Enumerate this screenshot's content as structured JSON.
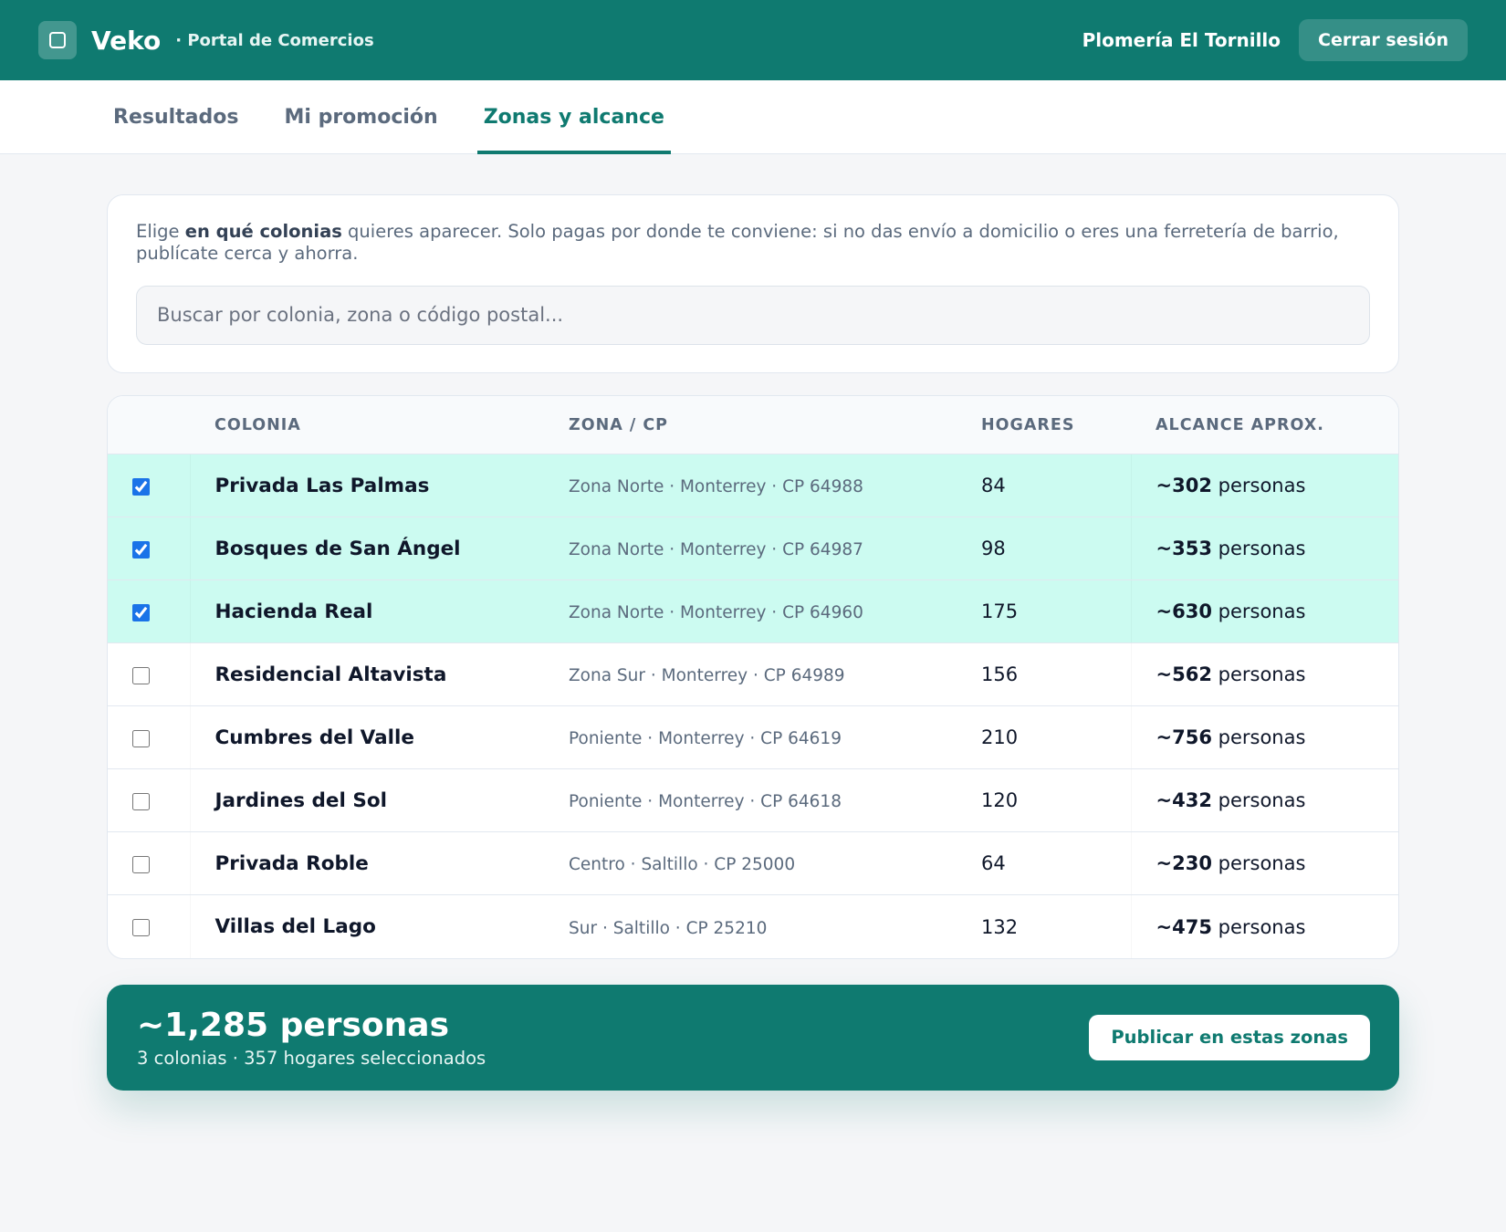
{
  "header": {
    "brand": "Veko",
    "subtitle": "· Portal de Comercios",
    "business_name": "Plomería El Tornillo",
    "logout_label": "Cerrar sesión"
  },
  "tabs": [
    {
      "label": "Resultados",
      "active": false
    },
    {
      "label": "Mi promoción",
      "active": false
    },
    {
      "label": "Zonas y alcance",
      "active": true
    }
  ],
  "intro": {
    "text_before": "Elige ",
    "text_bold": "en qué colonias",
    "text_after": " quieres aparecer. Solo pagas por donde te conviene: si no das envío a domicilio o eres una ferretería de barrio, publícate cerca y ahorra.",
    "search_placeholder": "Buscar por colonia, zona o código postal..."
  },
  "table": {
    "headers": {
      "colonia": "COLONIA",
      "zona": "ZONA / CP",
      "hogares": "HOGARES",
      "alcance": "ALCANCE APROX."
    },
    "reach_unit": "personas",
    "rows": [
      {
        "name": "Privada Las Palmas",
        "zone": "Zona Norte · Monterrey · CP 64988",
        "homes": "84",
        "reach": "~302",
        "checked": true
      },
      {
        "name": "Bosques de San Ángel",
        "zone": "Zona Norte · Monterrey · CP 64987",
        "homes": "98",
        "reach": "~353",
        "checked": true
      },
      {
        "name": "Hacienda Real",
        "zone": "Zona Norte · Monterrey · CP 64960",
        "homes": "175",
        "reach": "~630",
        "checked": true
      },
      {
        "name": "Residencial Altavista",
        "zone": "Zona Sur · Monterrey · CP 64989",
        "homes": "156",
        "reach": "~562",
        "checked": false
      },
      {
        "name": "Cumbres del Valle",
        "zone": "Poniente · Monterrey · CP 64619",
        "homes": "210",
        "reach": "~756",
        "checked": false
      },
      {
        "name": "Jardines del Sol",
        "zone": "Poniente · Monterrey · CP 64618",
        "homes": "120",
        "reach": "~432",
        "checked": false
      },
      {
        "name": "Privada Roble",
        "zone": "Centro · Saltillo · CP 25000",
        "homes": "64",
        "reach": "~230",
        "checked": false
      },
      {
        "name": "Villas del Lago",
        "zone": "Sur · Saltillo · CP 25210",
        "homes": "132",
        "reach": "~475",
        "checked": false
      }
    ]
  },
  "summary": {
    "title": "~1,285 personas",
    "subtitle": "3 colonias · 357 hogares seleccionados",
    "publish_label": "Publicar en estas zonas"
  },
  "colors": {
    "brand": "#0f7a70",
    "selected_row": "#ccfbf1",
    "checkbox": "#1a73e8"
  }
}
